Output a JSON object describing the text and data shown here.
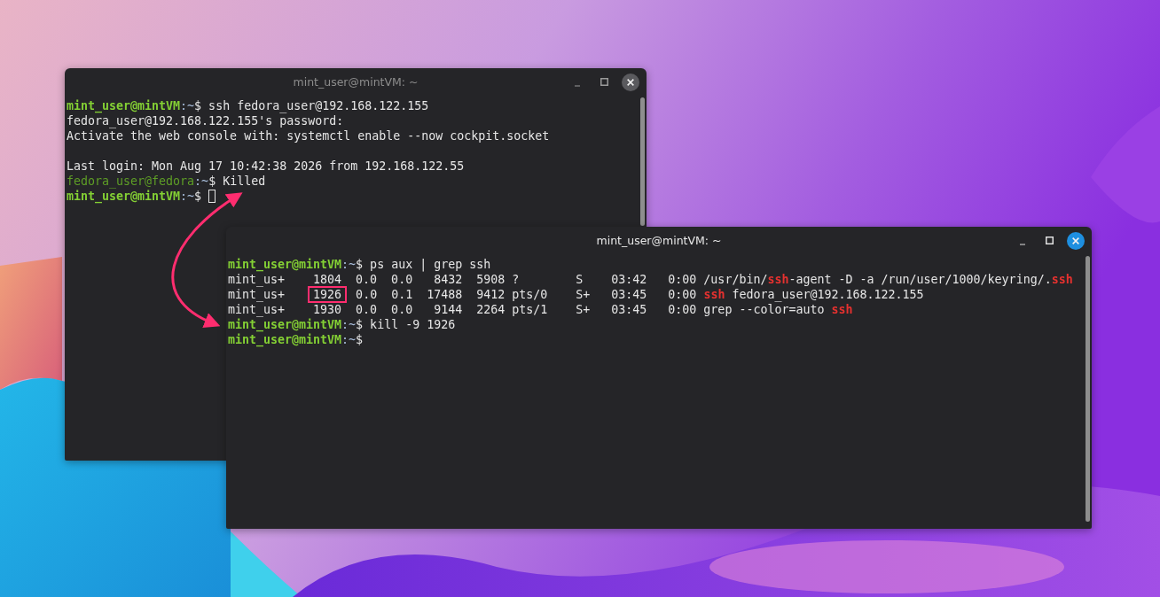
{
  "windows": [
    {
      "title": "mint_user@mintVM: ~",
      "active": false,
      "lines": [
        {
          "kind": "text",
          "segments": [
            {
              "kind": "user",
              "text": "mint_user@mintVM"
            },
            {
              "kind": "path",
              "text": ":~"
            },
            {
              "kind": "text",
              "text": "$ ssh fedora_user@192.168.122.155"
            }
          ]
        },
        {
          "kind": "text",
          "segments": [
            {
              "kind": "text",
              "text": "fedora_user@192.168.122.155's password:"
            }
          ]
        },
        {
          "kind": "text",
          "segments": [
            {
              "kind": "text",
              "text": "Activate the web console with: systemctl enable --now cockpit.socket"
            }
          ]
        },
        {
          "kind": "blank"
        },
        {
          "kind": "text",
          "segments": [
            {
              "kind": "text",
              "text": "Last login: Mon Aug 17 10:42:38 2026 from 192.168.122.55"
            }
          ]
        },
        {
          "kind": "text",
          "segments": [
            {
              "kind": "remote_user",
              "text": "fedora_user@fedora"
            },
            {
              "kind": "path",
              "text": ":~"
            },
            {
              "kind": "text",
              "text": "$ Killed"
            }
          ]
        },
        {
          "kind": "text",
          "cursor": true,
          "segments": [
            {
              "kind": "user",
              "text": "mint_user@mintVM"
            },
            {
              "kind": "path",
              "text": ":~"
            },
            {
              "kind": "text",
              "text": "$ "
            }
          ]
        }
      ]
    },
    {
      "title": "mint_user@mintVM: ~",
      "active": true,
      "lines": [
        {
          "kind": "text",
          "segments": [
            {
              "kind": "user",
              "text": "mint_user@mintVM"
            },
            {
              "kind": "path",
              "text": ":~"
            },
            {
              "kind": "text",
              "text": "$ ps aux | grep ssh"
            }
          ]
        },
        {
          "kind": "text",
          "segments": [
            {
              "kind": "text",
              "text": "mint_us+    1804  0.0  0.0   8432  5908 ?        S    03:42   0:00 /usr/bin/"
            },
            {
              "kind": "match",
              "text": "ssh"
            },
            {
              "kind": "text",
              "text": "-agent -D -a /run/user/1000/keyring/."
            },
            {
              "kind": "match",
              "text": "ssh"
            }
          ]
        },
        {
          "kind": "text",
          "segments": [
            {
              "kind": "text",
              "text": "mint_us+    "
            },
            {
              "kind": "text",
              "text": "1926",
              "highlighted": true
            },
            {
              "kind": "text",
              "text": "  0.0  0.1  17488  9412 pts/0    S+   03:45   0:00 "
            },
            {
              "kind": "match",
              "text": "ssh"
            },
            {
              "kind": "text",
              "text": " fedora_user@192.168.122.155"
            }
          ]
        },
        {
          "kind": "text",
          "segments": [
            {
              "kind": "text",
              "text": "mint_us+    1930  0.0  0.0   9144  2264 pts/1    S+   03:45   0:00 grep --color=auto "
            },
            {
              "kind": "match",
              "text": "ssh"
            }
          ]
        },
        {
          "kind": "text",
          "segments": [
            {
              "kind": "user",
              "text": "mint_user@mintVM"
            },
            {
              "kind": "path",
              "text": ":~"
            },
            {
              "kind": "text",
              "text": "$ kill -9 1926"
            }
          ]
        },
        {
          "kind": "text",
          "segments": [
            {
              "kind": "user",
              "text": "mint_user@mintVM"
            },
            {
              "kind": "path",
              "text": ":~"
            },
            {
              "kind": "text",
              "text": "$"
            }
          ]
        }
      ]
    }
  ]
}
